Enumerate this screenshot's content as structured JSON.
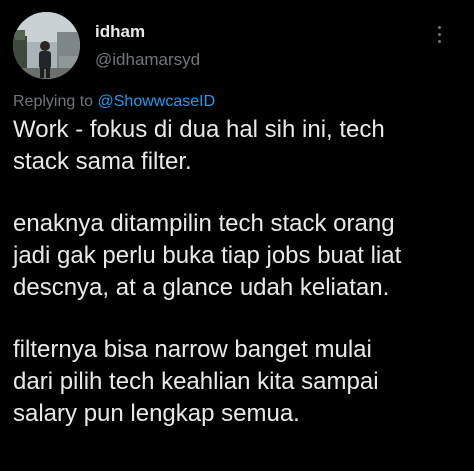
{
  "author": {
    "name": "idham",
    "handle": "@idhamarsyd"
  },
  "reply": {
    "prefix": "Replying to",
    "mention": "@ShowwcaseID"
  },
  "tweet": {
    "paragraphs": [
      "Work - fokus di dua hal sih ini, tech\nstack sama filter.",
      "enaknya ditampilin tech stack orang\njadi gak perlu buka tiap jobs buat liat\ndescnya, at a glance udah keliatan.",
      "filternya bisa narrow banget mulai\ndari pilih tech keahlian kita sampai\nsalary pun lengkap semua."
    ]
  },
  "icons": {
    "more": "more-options-icon",
    "avatar": "profile-photo"
  },
  "colors": {
    "background": "#000000",
    "text": "#e7e9ea",
    "secondary": "#71767b",
    "accent": "#1d9bf0"
  }
}
